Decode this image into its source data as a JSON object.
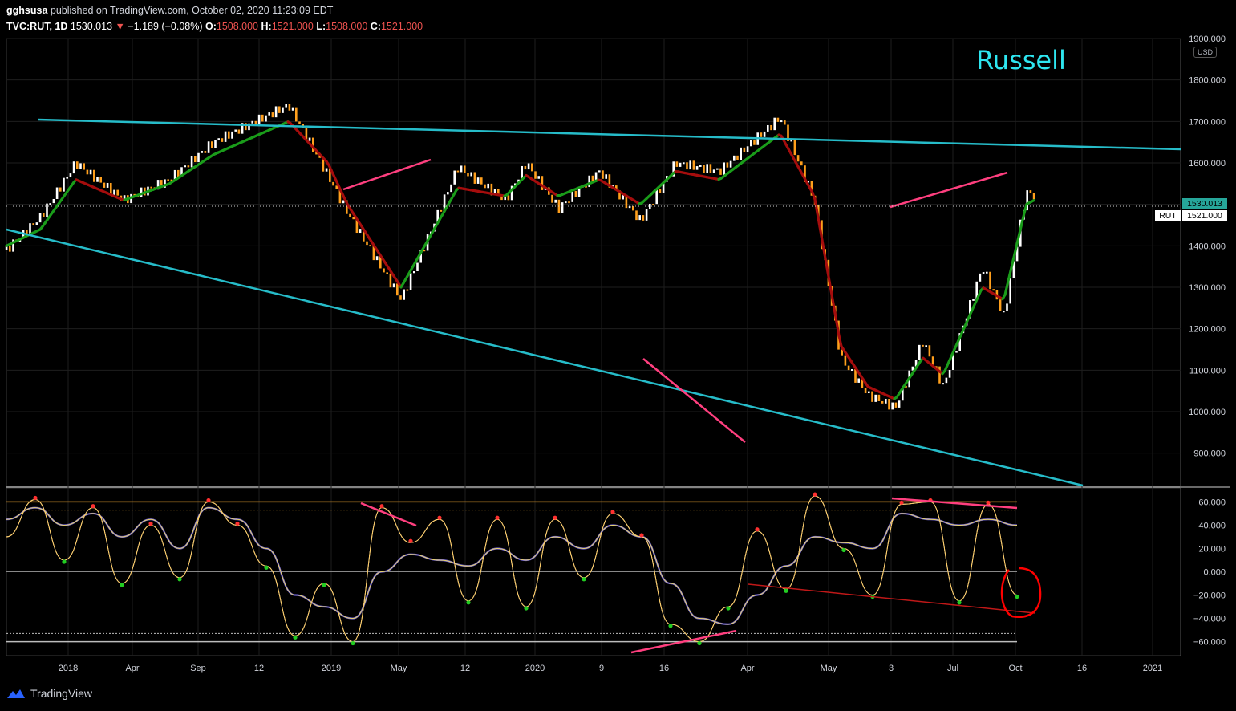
{
  "header": {
    "publisher": "gghsusa",
    "published_text": "published on TradingView.com, October 02, 2020 11:23:09 EDT",
    "symbol": "TVC:RUT, 1D",
    "last": "1530.013",
    "change": "−1.189 (−0.08%)",
    "o_label": "O:",
    "o": "1508.000",
    "h_label": "H:",
    "h": "1521.000",
    "l_label": "L:",
    "l": "1508.000",
    "c_label": "C:",
    "c": "1521.000"
  },
  "annotation_title": "Russell",
  "currency": "USD",
  "price_badges": {
    "last": "1530.013",
    "rut_label": "RUT",
    "rut_value": "1521.000"
  },
  "brand": "TradingView",
  "colors": {
    "background": "#000000",
    "trendline": "#26bcc9",
    "divergence": "#ff3f7f",
    "ma_up": "#1a9c1a",
    "ma_down": "#a50d0d",
    "candle_up": "#ffffff",
    "candle_down": "#ff9f1c",
    "osc_fast": "#ffcb60",
    "osc_slow": "#6b5fd6",
    "osc_level_upper": "#c88a2a",
    "annotation_text": "#2ee6f0",
    "highlight_circle": "#ff0000"
  },
  "chart_data": [
    {
      "type": "line",
      "name": "price",
      "ylim": [
        820,
        1900
      ],
      "y_ticks": [
        900,
        1000,
        1100,
        1200,
        1300,
        1400,
        1500,
        1600,
        1700,
        1800,
        1900
      ],
      "y_tick_labels": [
        "900.000",
        "1000.000",
        "1100.000",
        "1200.000",
        "1300.000",
        "1400.000",
        "1500.000",
        "1600.000",
        "1700.000",
        "1800.000",
        "1900.000"
      ],
      "x_tick_labels": [
        "2018",
        "Apr",
        "Sep",
        "12",
        "2019",
        "May",
        "12",
        "2020",
        "9",
        "16",
        "Apr",
        "May",
        "3",
        "Jul",
        "Oct",
        "16",
        "2021"
      ],
      "x": [
        "2017-11-15",
        "2017-12-20",
        "2018-01-25",
        "2018-03-15",
        "2018-05-01",
        "2018-06-15",
        "2018-08-31",
        "2018-10-10",
        "2018-10-30",
        "2018-12-24",
        "2019-02-20",
        "2019-04-10",
        "2019-05-01",
        "2019-06-03",
        "2019-07-15",
        "2019-08-26",
        "2019-10-01",
        "2019-11-15",
        "2020-01-16",
        "2020-02-20",
        "2020-03-18",
        "2020-04-15",
        "2020-05-13",
        "2020-06-10",
        "2020-07-01",
        "2020-08-10",
        "2020-09-01",
        "2020-09-24",
        "2020-10-02"
      ],
      "price": [
        1390,
        1470,
        1600,
        1510,
        1560,
        1650,
        1740,
        1570,
        1480,
        1270,
        1590,
        1510,
        1600,
        1490,
        1580,
        1460,
        1600,
        1580,
        1710,
        1510,
        1130,
        1040,
        1010,
        1170,
        1060,
        1350,
        1230,
        1530,
        1521
      ],
      "ma": [
        1400,
        1440,
        1560,
        1510,
        1550,
        1620,
        1700,
        1600,
        1500,
        1300,
        1540,
        1520,
        1570,
        1520,
        1560,
        1500,
        1580,
        1560,
        1670,
        1520,
        1160,
        1060,
        1030,
        1130,
        1090,
        1300,
        1270,
        1500,
        1510
      ]
    },
    {
      "type": "line",
      "name": "oscillator",
      "ylim": [
        -72,
        72
      ],
      "y_ticks": [
        60,
        40,
        20,
        0,
        -20,
        -40,
        -60
      ],
      "y_tick_labels": [
        "60.000",
        "40.000",
        "20.000",
        "0.000",
        "−20.000",
        "−40.000",
        "−60.000"
      ],
      "levels": [
        60,
        53,
        0,
        -53,
        -60
      ],
      "fast": [
        30,
        62,
        10,
        55,
        -10,
        40,
        -5,
        60,
        40,
        5,
        -55,
        -10,
        -60,
        55,
        25,
        45,
        -25,
        45,
        -30,
        45,
        -5,
        50,
        30,
        -45,
        -60,
        -30,
        35,
        -15,
        65,
        20,
        -20,
        58,
        60,
        -25,
        58,
        -20
      ],
      "slow": [
        45,
        55,
        40,
        50,
        30,
        45,
        20,
        55,
        45,
        20,
        -20,
        -30,
        -40,
        0,
        15,
        10,
        5,
        20,
        10,
        30,
        20,
        40,
        30,
        -10,
        -40,
        -45,
        -20,
        5,
        30,
        25,
        20,
        50,
        45,
        40,
        45,
        40
      ]
    }
  ]
}
